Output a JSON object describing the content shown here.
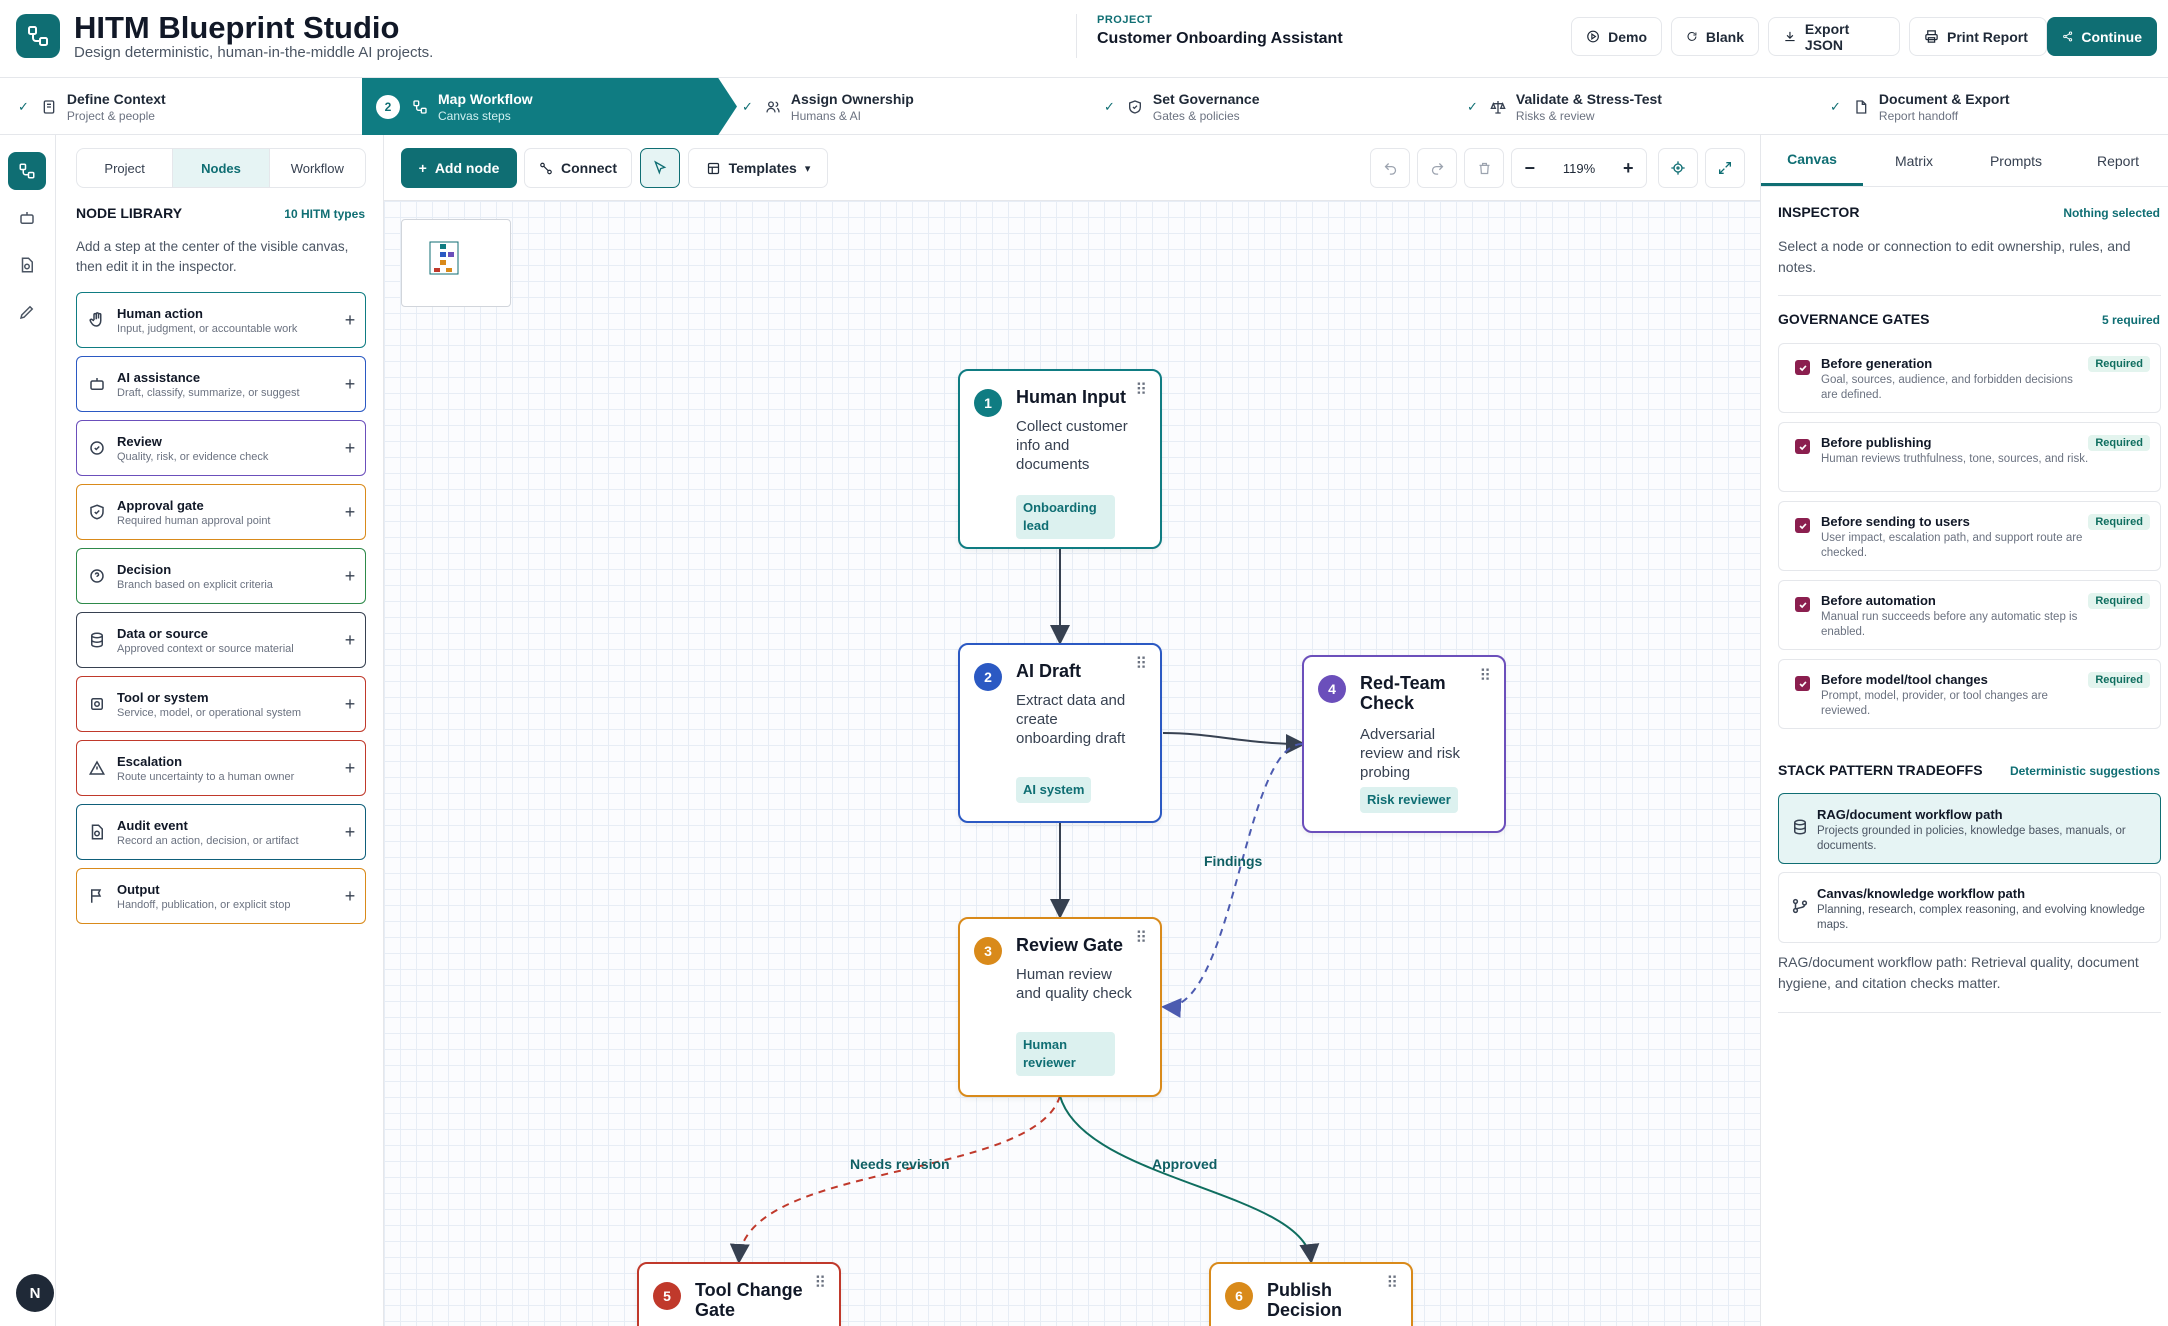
{
  "app": {
    "title": "HITM Blueprint Studio",
    "subtitle": "Design deterministic, human-in-the-middle AI projects."
  },
  "project": {
    "label": "PROJECT",
    "name": "Customer Onboarding Assistant"
  },
  "toolbar": {
    "demo": "Demo",
    "blank": "Blank",
    "export": "Export JSON",
    "print": "Print Report",
    "continue": "Continue"
  },
  "steps": [
    {
      "title": "Define Context",
      "sub": "Project & people",
      "state": "done",
      "icon": "briefcase-icon"
    },
    {
      "title": "Map Workflow",
      "sub": "Canvas steps",
      "state": "active",
      "num": "2",
      "icon": "workflow-icon"
    },
    {
      "title": "Assign Ownership",
      "sub": "Humans & AI",
      "state": "done",
      "icon": "users-icon"
    },
    {
      "title": "Set Governance",
      "sub": "Gates & policies",
      "state": "done",
      "icon": "shield-icon"
    },
    {
      "title": "Validate & Stress-Test",
      "sub": "Risks & review",
      "state": "done",
      "icon": "scale-icon"
    },
    {
      "title": "Document & Export",
      "sub": "Report handoff",
      "state": "done",
      "icon": "document-icon"
    }
  ],
  "user": {
    "initial": "N"
  },
  "library": {
    "tabs": [
      "Project",
      "Nodes",
      "Workflow"
    ],
    "active_tab": "Nodes",
    "heading": "NODE LIBRARY",
    "count": "10 HITM types",
    "desc": "Add a step at the center of the visible canvas, then edit it in the inspector.",
    "items": [
      {
        "title": "Human action",
        "desc": "Input, judgment, or accountable work",
        "color": "#0f7c82",
        "icon": "hand-icon"
      },
      {
        "title": "AI assistance",
        "desc": "Draft, classify, summarize, or suggest",
        "color": "#2b59c3",
        "icon": "robot-icon"
      },
      {
        "title": "Review",
        "desc": "Quality, risk, or evidence check",
        "color": "#6b4fbb",
        "icon": "check-circle-icon"
      },
      {
        "title": "Approval gate",
        "desc": "Required human approval point",
        "color": "#d98a1a",
        "icon": "shield-check-icon"
      },
      {
        "title": "Decision",
        "desc": "Branch based on explicit criteria",
        "color": "#2e8a4a",
        "icon": "question-icon"
      },
      {
        "title": "Data or source",
        "desc": "Approved context or source material",
        "color": "#374151",
        "icon": "database-icon"
      },
      {
        "title": "Tool or system",
        "desc": "Service, model, or operational system",
        "color": "#c0392b",
        "icon": "cpu-icon"
      },
      {
        "title": "Escalation",
        "desc": "Route uncertainty to a human owner",
        "color": "#c0392b",
        "icon": "warning-icon"
      },
      {
        "title": "Audit event",
        "desc": "Record an action, decision, or artifact",
        "color": "#0f5f7a",
        "icon": "file-audit-icon"
      },
      {
        "title": "Output",
        "desc": "Handoff, publication, or explicit stop",
        "color": "#d98a1a",
        "icon": "flag-icon"
      }
    ]
  },
  "canvas": {
    "add_node": "Add node",
    "connect": "Connect",
    "templates": "Templates",
    "zoom": "119%",
    "nodes": [
      {
        "num": "1",
        "title": "Human Input",
        "desc": "Collect customer info and documents",
        "tag": "Onboarding lead",
        "color": "#0f7c82"
      },
      {
        "num": "2",
        "title": "AI Draft",
        "desc": "Extract data and create onboarding draft",
        "tag": "AI system",
        "color": "#2b59c3"
      },
      {
        "num": "3",
        "title": "Review Gate",
        "desc": "Human review and quality check",
        "tag": "Human reviewer",
        "color": "#d98a1a"
      },
      {
        "num": "4",
        "title": "Red-Team Check",
        "desc": "Adversarial review and risk probing",
        "tag": "Risk reviewer",
        "color": "#6b4fbb"
      },
      {
        "num": "5",
        "title": "Tool Change Gate",
        "color": "#c0392b"
      },
      {
        "num": "6",
        "title": "Publish Decision",
        "color": "#d98a1a"
      }
    ],
    "edges": {
      "findings": "Findings",
      "needs_revision": "Needs revision",
      "approved": "Approved"
    }
  },
  "inspector": {
    "tabs": [
      "Canvas",
      "Matrix",
      "Prompts",
      "Report"
    ],
    "active_tab": "Canvas",
    "heading": "INSPECTOR",
    "status": "Nothing selected",
    "hint": "Select a node or connection to edit ownership, rules, and notes.",
    "gates_heading": "GOVERNANCE GATES",
    "gates_count": "5 required",
    "gates": [
      {
        "title": "Before generation",
        "desc": "Goal, sources, audience, and forbidden decisions are defined.",
        "badge": "Required"
      },
      {
        "title": "Before publishing",
        "desc": "Human reviews truthfulness, tone, sources, and risk.",
        "badge": "Required"
      },
      {
        "title": "Before sending to users",
        "desc": "User impact, escalation path, and support route are checked.",
        "badge": "Required"
      },
      {
        "title": "Before automation",
        "desc": "Manual run succeeds before any automatic step is enabled.",
        "badge": "Required"
      },
      {
        "title": "Before model/tool changes",
        "desc": "Prompt, model, provider, or tool changes are reviewed.",
        "badge": "Required"
      }
    ],
    "stack_heading": "STACK PATTERN TRADEOFFS",
    "stack_note": "Deterministic suggestions",
    "patterns": [
      {
        "title": "RAG/document workflow path",
        "desc": "Projects grounded in policies, knowledge bases, manuals, or documents.",
        "icon": "database-icon"
      },
      {
        "title": "Canvas/knowledge workflow path",
        "desc": "Planning, research, complex reasoning, and evolving knowledge maps.",
        "icon": "branch-icon"
      }
    ],
    "pattern_note": "RAG/document workflow path: Retrieval quality, document hygiene, and citation checks matter."
  }
}
